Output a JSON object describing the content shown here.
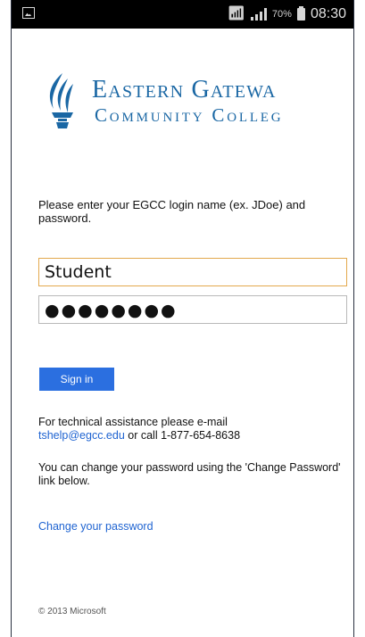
{
  "status_bar": {
    "battery_percent": "70%",
    "time": "08:30",
    "icons": [
      "gallery-icon",
      "wifi-icon",
      "signal-icon",
      "battery-icon"
    ]
  },
  "logo": {
    "line1": "Eastern Gatewa",
    "line2": "Community Colleg",
    "color": "#1a67a4"
  },
  "login": {
    "prompt": "Please enter your EGCC login name (ex. JDoe) and password.",
    "username_value": "Student",
    "password_value": "●●●●●●●●",
    "signin_label": "Sign in"
  },
  "help": {
    "text_before": "For technical assistance please e-mail",
    "email": "tshelp@egcc.edu",
    "text_after": " or call 1-877-654-8638",
    "change_info": "You can change your password using the 'Change Password' link below.",
    "change_link": "Change your password"
  },
  "footer": {
    "copyright": "© 2013 Microsoft"
  },
  "colors": {
    "accent": "#2b6fe0",
    "link": "#1e63d1",
    "focus_border": "#e3a94d"
  }
}
